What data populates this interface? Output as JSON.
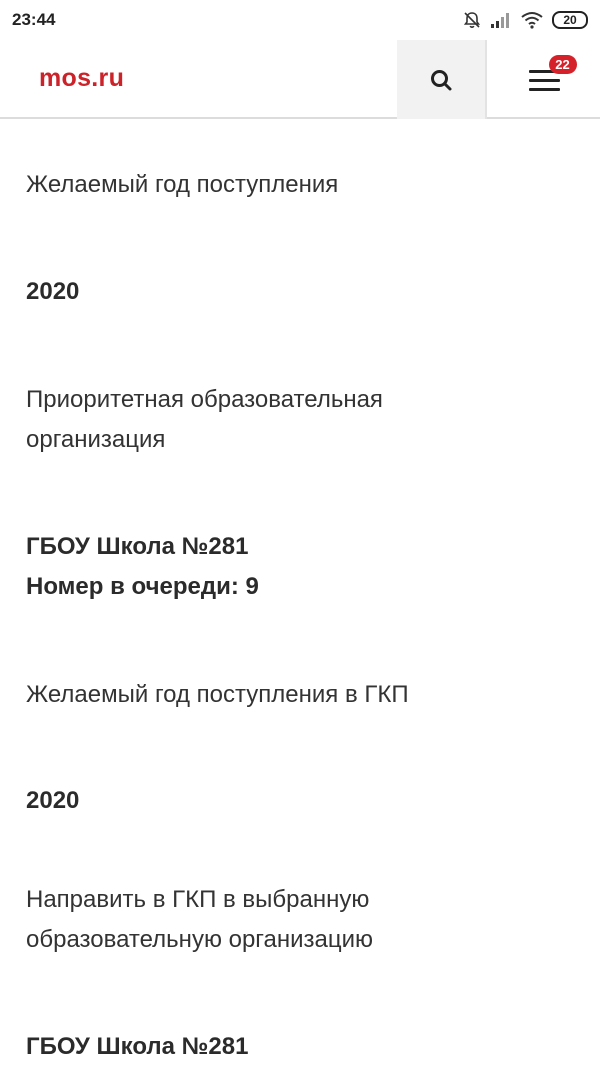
{
  "status_bar": {
    "time": "23:44",
    "battery": "20",
    "icons": [
      "bell-muted-icon",
      "signal-icon",
      "wifi-icon",
      "battery-icon"
    ]
  },
  "header": {
    "logo": "mos.ru",
    "search_icon": "search-icon",
    "menu_icon": "hamburger-menu-icon",
    "menu_badge": "22",
    "accent_color": "#cc2229"
  },
  "content": {
    "field1_label": "Желаемый год поступления",
    "field1_value": "2020",
    "field2_label_line1": "Приоритетная образовательная",
    "field2_label_line2": "организация",
    "field2_value_line1": "ГБОУ Школа №281",
    "field2_value_line2": "Номер в очереди: 9",
    "field3_label": "Желаемый год поступления в ГКП",
    "field3_value": "2020",
    "field4_label_line1": "Направить в ГКП в выбранную",
    "field4_label_line2": "образовательную организацию",
    "field4_value": "ГБОУ Школа №281"
  }
}
